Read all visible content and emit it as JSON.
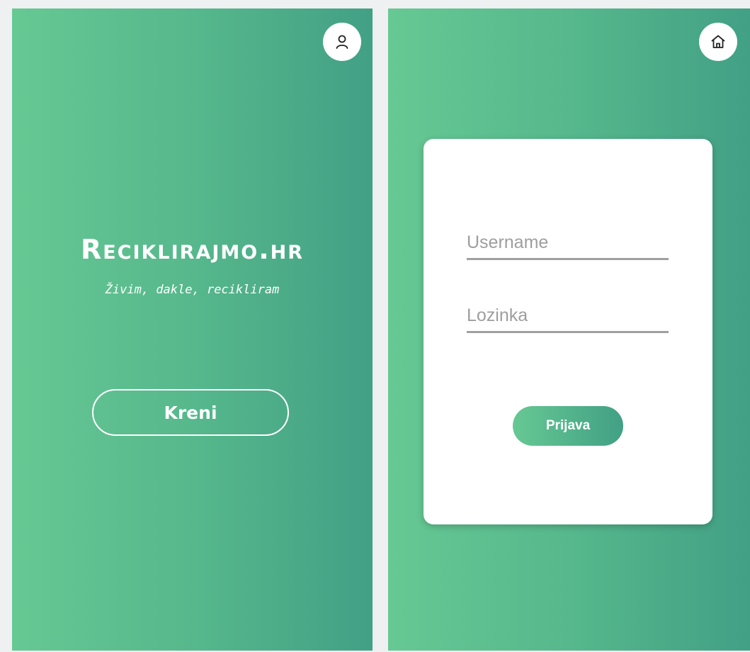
{
  "landing": {
    "title": "Reciklirajmo.hr",
    "tagline": "Živim, dakle, recikliram",
    "start_label": "Kreni",
    "profile_icon": "user-icon"
  },
  "login": {
    "home_icon": "home-icon",
    "username_placeholder": "Username",
    "password_placeholder": "Lozinka",
    "username_value": "",
    "password_value": "",
    "submit_label": "Prijava"
  },
  "colors": {
    "gradient_start": "#66c893",
    "gradient_end": "#42a085",
    "card_bg": "#ffffff",
    "underline": "#a0a0a0"
  }
}
